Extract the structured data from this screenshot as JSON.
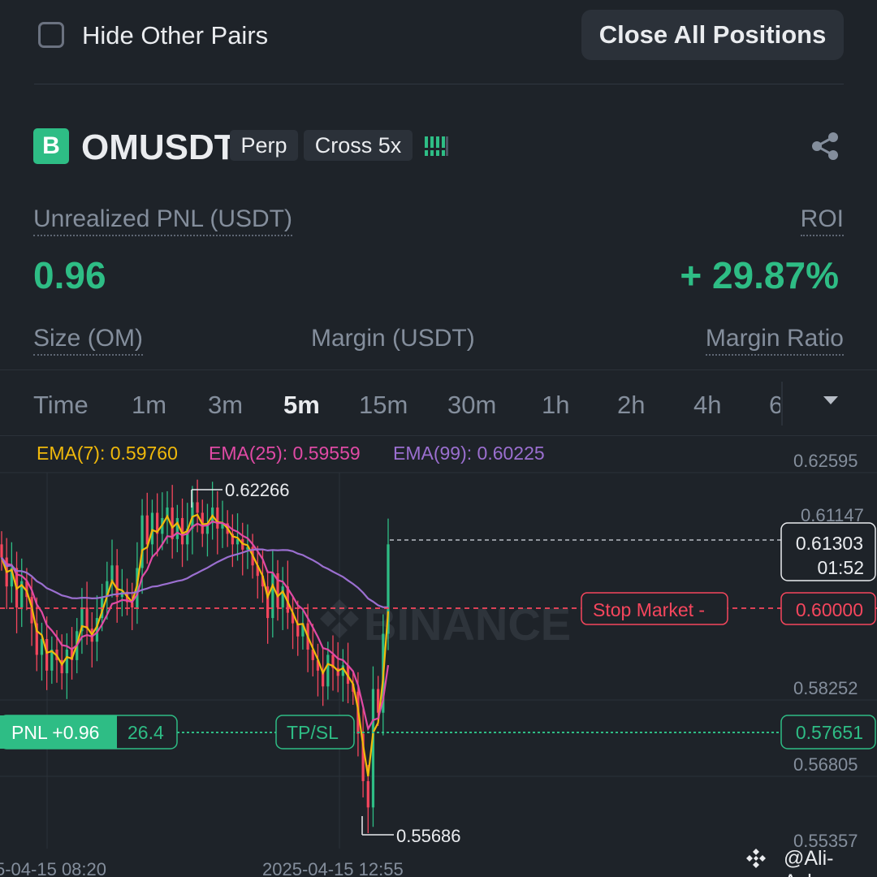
{
  "header": {
    "hide_other_pairs_label": "Hide Other Pairs",
    "close_all_label": "Close All Positions"
  },
  "position": {
    "badge": "B",
    "symbol": "OMUSDT",
    "contract_type": "Perp",
    "margin_mode": "Cross 5x",
    "unrealized_pnl_label": "Unrealized PNL (USDT)",
    "unrealized_pnl": "0.96",
    "roi_label": "ROI",
    "roi": "+ 29.87%",
    "size_label": "Size (OM)",
    "margin_label": "Margin (USDT)",
    "margin_ratio_label": "Margin Ratio"
  },
  "timeframes": {
    "items": [
      "Time",
      "1m",
      "3m",
      "5m",
      "15m",
      "30m",
      "1h",
      "2h",
      "4h",
      "6"
    ],
    "active": "5m"
  },
  "indicators": {
    "ema7": "EMA(7): 0.59760",
    "ema25": "EMA(25): 0.59559",
    "ema99": "EMA(99): 0.60225"
  },
  "chart": {
    "price_axis": [
      "0.62595",
      "0.58252",
      "0.56805",
      "0.55357"
    ],
    "last_price": "0.61303",
    "countdown": "01:52",
    "partial_hidden_label": "0.61147",
    "stop_market_label": "Stop Market  -",
    "stop_price": "0.60000",
    "pnl_label": "PNL +0.96",
    "pnl_roe": "26.4",
    "tpsl_label": "TP/SL",
    "entry_price": "0.57651",
    "high_label": "0.62266",
    "low_label": "0.55686",
    "time_axis": [
      "5-04-15 08:20",
      "2025-04-15 12:55"
    ],
    "watermark": "BINANCE"
  },
  "credit": "@Ali-Azhar",
  "colors": {
    "up": "#2ebd85",
    "down": "#f6465d",
    "ema7": "#f0b90b",
    "ema25": "#e04aa5",
    "ema99": "#9b6fd0",
    "bg": "#1e2329"
  },
  "icons": {
    "checkbox": "checkbox-empty-icon",
    "adl": "adl-bars-icon",
    "share": "share-icon",
    "dropdown": "chevron-down-icon",
    "watermark": "binance-logo-icon"
  }
}
